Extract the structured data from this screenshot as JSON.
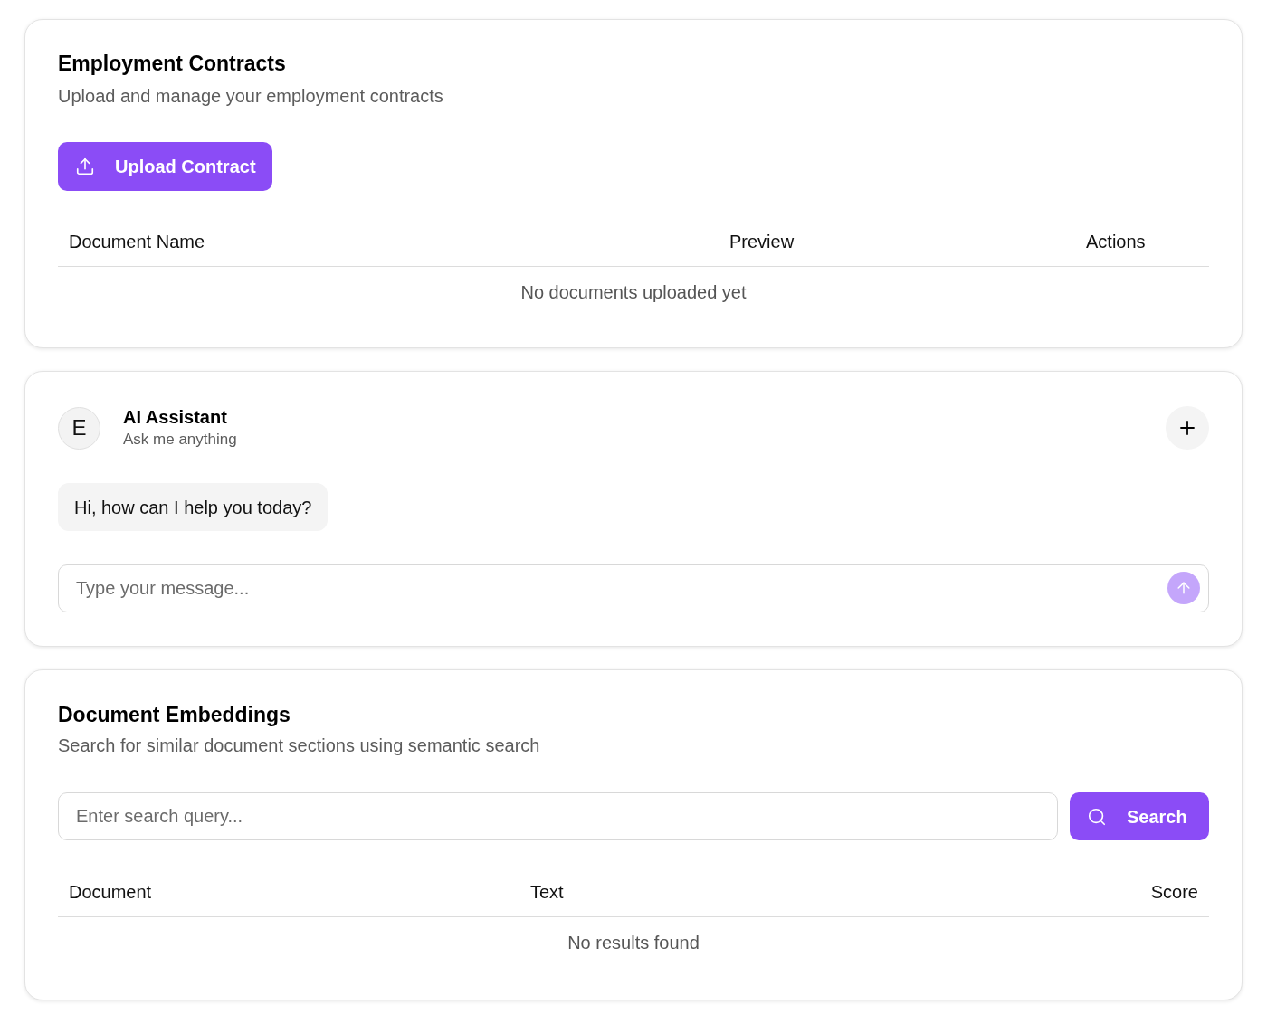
{
  "contracts_panel": {
    "title": "Employment Contracts",
    "subtitle": "Upload and manage your employment contracts",
    "upload_button": {
      "label": "Upload Contract"
    },
    "table": {
      "columns": [
        "Document Name",
        "Preview",
        "Actions"
      ],
      "empty_message": "No documents uploaded yet"
    }
  },
  "assistant_panel": {
    "avatar": {
      "initial": "E"
    },
    "name": "AI Assistant",
    "tagline": "Ask me anything",
    "messages": [
      "Hi, how can I help you today?"
    ],
    "input": {
      "placeholder": "Type your message..."
    },
    "send_button": {
      "disabled": true
    }
  },
  "embeddings_panel": {
    "title": "Document Embeddings",
    "subtitle": "Search for similar document sections using semantic search",
    "search": {
      "placeholder": "Enter search query..."
    },
    "search_button": {
      "label": "Search"
    },
    "table": {
      "columns": [
        "Document",
        "Text",
        "Score"
      ],
      "empty_message": "No results found"
    }
  }
}
